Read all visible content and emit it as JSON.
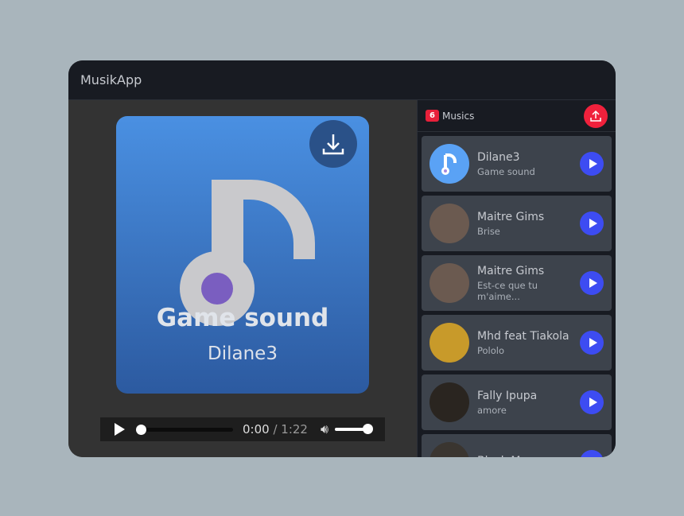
{
  "app": {
    "title": "MusikApp"
  },
  "now_playing": {
    "title": "Game sound",
    "artist": "Dilane3",
    "current_time": "0:00",
    "duration": "1:22",
    "progress": 0,
    "volume": 1
  },
  "playlist": {
    "count": "6",
    "label": "Musics",
    "items": [
      {
        "artist": "Dilane3",
        "title": "Game sound",
        "avatar": "#5aa2f5"
      },
      {
        "artist": "Maitre Gims",
        "title": "Brise",
        "avatar": "#6b5a50"
      },
      {
        "artist": "Maitre Gims",
        "title": "Est-ce que tu m'aime...",
        "avatar": "#6b5a50"
      },
      {
        "artist": "Mhd feat Tiakola",
        "title": "Pololo",
        "avatar": "#c89a2a"
      },
      {
        "artist": "Fally Ipupa",
        "title": "amore",
        "avatar": "#2a2520"
      },
      {
        "artist": "Black M",
        "title": "",
        "avatar": "#3a3530"
      }
    ]
  }
}
